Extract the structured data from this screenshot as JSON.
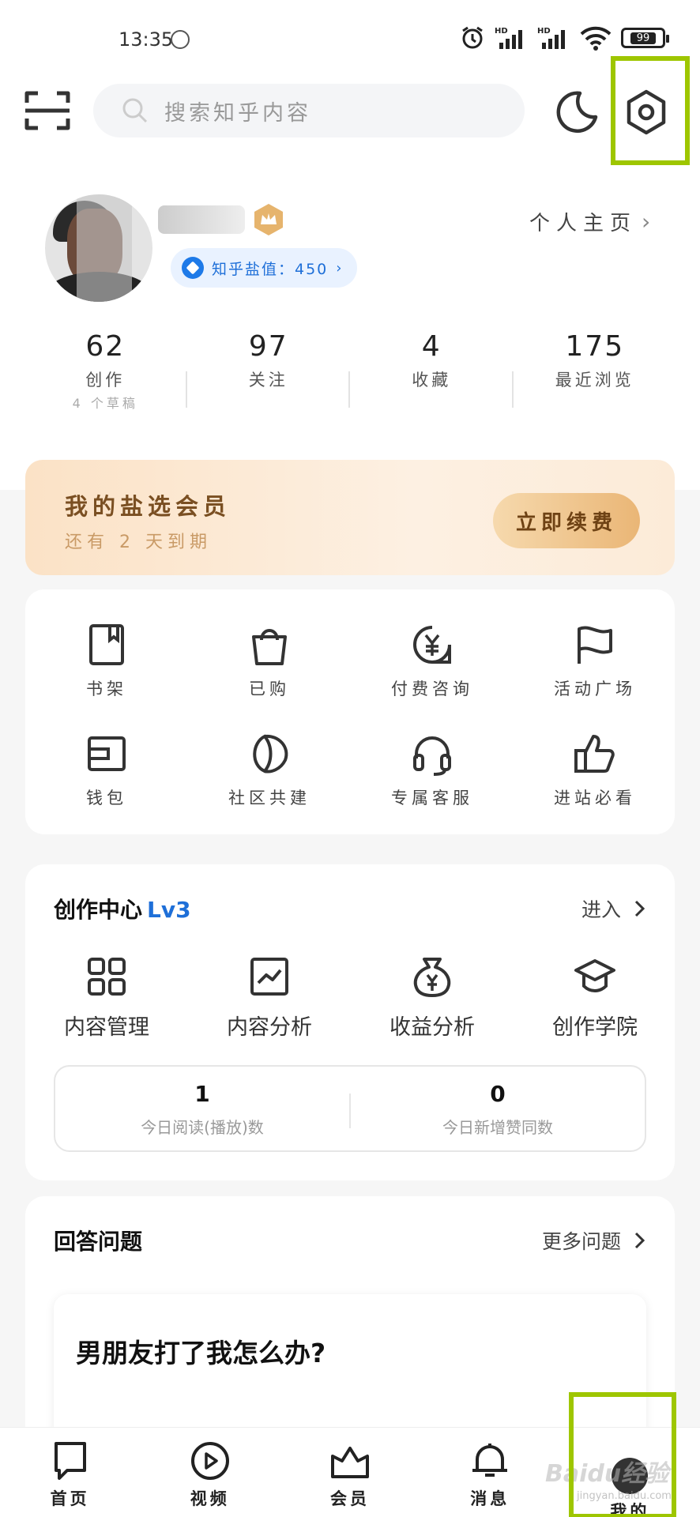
{
  "status_bar": {
    "time": "13:35",
    "battery": "99"
  },
  "header": {
    "search_placeholder": "搜索知乎内容"
  },
  "profile": {
    "salt_label": "知乎盐值：450",
    "homepage_link": "个人主页"
  },
  "stats": [
    {
      "num": "62",
      "label": "创作",
      "sub": "4 个草稿"
    },
    {
      "num": "97",
      "label": "关注",
      "sub": ""
    },
    {
      "num": "4",
      "label": "收藏",
      "sub": ""
    },
    {
      "num": "175",
      "label": "最近浏览",
      "sub": ""
    }
  ],
  "vip": {
    "title": "我的盐选会员",
    "subtitle": "还有 2 天到期",
    "button": "立即续费"
  },
  "grid": [
    {
      "label": "书架",
      "icon": "bookshelf-icon"
    },
    {
      "label": "已购",
      "icon": "shopping-bag-icon"
    },
    {
      "label": "付费咨询",
      "icon": "paid-consult-icon"
    },
    {
      "label": "活动广场",
      "icon": "flag-icon"
    },
    {
      "label": "钱包",
      "icon": "wallet-icon"
    },
    {
      "label": "社区共建",
      "icon": "leaf-icon"
    },
    {
      "label": "专属客服",
      "icon": "headset-icon"
    },
    {
      "label": "进站必看",
      "icon": "thumbs-up-icon"
    }
  ],
  "creation": {
    "title": "创作中心",
    "level": "Lv3",
    "link": "进入",
    "items": [
      {
        "label": "内容管理",
        "icon": "grid-icon"
      },
      {
        "label": "内容分析",
        "icon": "chart-icon"
      },
      {
        "label": "收益分析",
        "icon": "money-bag-icon"
      },
      {
        "label": "创作学院",
        "icon": "graduation-cap-icon"
      }
    ],
    "today": [
      {
        "num": "1",
        "label": "今日阅读(播放)数"
      },
      {
        "num": "0",
        "label": "今日新增赞同数"
      }
    ]
  },
  "answer": {
    "title": "回答问题",
    "link": "更多问题",
    "question": "男朋友打了我怎么办?"
  },
  "nav": [
    {
      "label": "首页",
      "icon": "home-icon"
    },
    {
      "label": "视频",
      "icon": "video-icon"
    },
    {
      "label": "会员",
      "icon": "crown-icon"
    },
    {
      "label": "消息",
      "icon": "bell-icon"
    },
    {
      "label": "我的",
      "icon": "profile-avatar-icon"
    }
  ],
  "watermark": {
    "main": "Baidu经验",
    "sub": "jingyan.baidu.com"
  },
  "colors": {
    "accent": "#1e6fd8",
    "highlight": "#9ec600",
    "vip_gold": "#eab676"
  }
}
